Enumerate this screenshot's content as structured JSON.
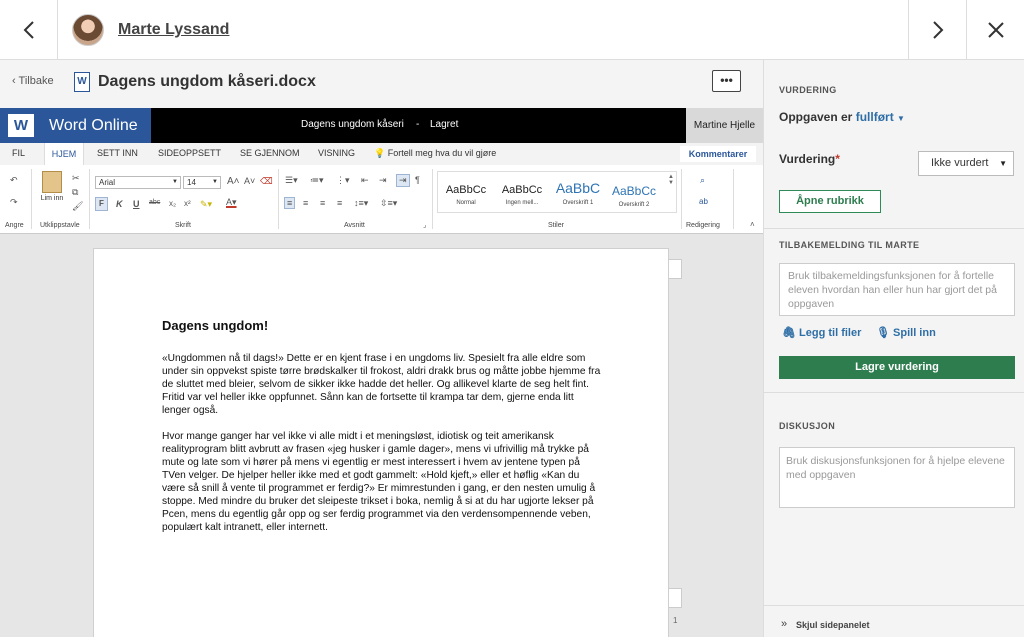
{
  "topbar": {
    "student_name": "Marte Lyssand",
    "prev_icon": "chevron-left",
    "next_icon": "chevron-right",
    "close_icon": "close"
  },
  "doc_header": {
    "back_label": "Tilbake",
    "file_name": "Dagens ungdom kåseri.docx",
    "more_label": "•••"
  },
  "word": {
    "app_name": "Word Online",
    "doc_title": "Dagens ungdom kåseri",
    "separator": "-",
    "save_status": "Lagret",
    "user": "Martine Hjelle",
    "tabs": [
      "FIL",
      "HJEM",
      "SETT INN",
      "SIDEOPPSETT",
      "SE GJENNOM",
      "VISNING"
    ],
    "tell_me": "Fortell meg hva du vil gjøre",
    "comments_label": "Kommentarer",
    "ribbon": {
      "font_name": "Arial",
      "font_size": "14",
      "paste_label": "Lim inn",
      "group_undo": "Angre",
      "group_clipboard": "Utklippstavle",
      "group_font": "Skrift",
      "group_paragraph": "Avsnitt",
      "group_styles": "Stiler",
      "group_editing": "Redigering",
      "styles": [
        {
          "sample": "AaBbCc",
          "name": "Normal"
        },
        {
          "sample": "AaBbCc",
          "name": "Ingen mell..."
        },
        {
          "sample": "AaBbC",
          "name": "Overskrift 1"
        },
        {
          "sample": "AaBbCc",
          "name": "Overskrift 2"
        }
      ]
    }
  },
  "document": {
    "heading": "Dagens ungdom!",
    "paragraphs": [
      "«Ungdommen nå til dags!» Dette er en kjent frase i en ungdoms liv. Spesielt fra alle eldre som under sin oppvekst spiste tørre brødskalker til frokost, aldri drakk brus og måtte jobbe hjemme fra de sluttet med bleier, selvom de sikker ikke hadde det heller. Og allikevel klarte de seg helt fint. Fritid var vel heller ikke oppfunnet. Sånn kan de fortsette til krampa tar dem, gjerne enda litt lenger også.",
      "Hvor mange ganger har vel ikke vi alle midt i et meningsløst, idiotisk og teit amerikansk realityprogram blitt avbrutt av frasen «jeg husker i gamle dager», mens vi ufrivillig må trykke på mute og late som vi hører på mens vi egentlig er mest interessert i hvem av jentene typen på TVen velger. De hjelper heller ikke med et godt gammelt: «Hold kjeft,» eller et høflig «Kan du være så snill å vente til programmet er ferdig?» Er mimrestunden i gang, er den nesten umulig å stoppe. Med mindre du bruker det sleipeste trikset i boka, nemlig å si at du har ugjorte lekser på Pcen, mens du egentlig går opp og ser ferdig programmet via den verdensompennende veben, populært kalt intranett, eller internett."
    ],
    "page_number": "1"
  },
  "side_panel": {
    "section_grading": "VURDERING",
    "status_prefix": "Oppgaven er",
    "status_value": "fullført",
    "grade_label": "Vurdering",
    "grade_required": "*",
    "grade_value": "Ikke vurdert",
    "rubric_button": "Åpne rubrikk",
    "feedback_label": "TILBAKEMELDING TIL MARTE",
    "feedback_placeholder": "Bruk tilbakemeldingsfunksjonen for å fortelle eleven hvordan han eller hun har gjort det på oppgaven",
    "attach_label": "Legg til filer",
    "record_label": "Spill inn",
    "save_button": "Lagre vurdering",
    "discussion_label": "DISKUSJON",
    "discussion_placeholder": "Bruk diskusjonsfunksjonen for å hjelpe elevene med oppgaven",
    "hide_panel_label": "Skjul sidepanelet"
  },
  "colors": {
    "word_blue": "#2b579a",
    "green": "#2e7d4f",
    "link_blue": "#2e6ea6"
  }
}
